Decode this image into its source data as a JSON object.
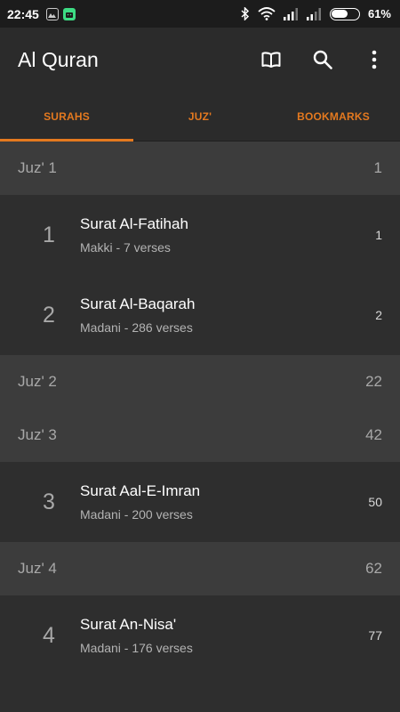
{
  "status_bar": {
    "time": "22:45",
    "battery_text": "61%",
    "battery_level": 0.61,
    "icons": [
      "gallery-icon",
      "android-icon",
      "bluetooth-icon",
      "wifi-icon",
      "signal-icon",
      "signal-icon",
      "battery-icon"
    ]
  },
  "app_bar": {
    "title": "Al Quran",
    "actions": [
      "book-icon",
      "search-icon",
      "overflow-menu-icon"
    ]
  },
  "tabs": [
    {
      "label": "SURAHS",
      "active": true
    },
    {
      "label": "JUZ'",
      "active": false
    },
    {
      "label": "BOOKMARKS",
      "active": false
    }
  ],
  "accent_color": "#e4791f",
  "list": {
    "juz": [
      {
        "label": "Juz' 1",
        "page": "1"
      },
      {
        "label": "Juz' 2",
        "page": "22"
      },
      {
        "label": "Juz' 3",
        "page": "42"
      },
      {
        "label": "Juz' 4",
        "page": "62"
      }
    ],
    "surahs": [
      {
        "number": "1",
        "name": "Surat Al-Fatihah",
        "meta": "Makki - 7 verses",
        "page": "1"
      },
      {
        "number": "2",
        "name": "Surat Al-Baqarah",
        "meta": "Madani - 286 verses",
        "page": "2"
      },
      {
        "number": "3",
        "name": "Surat Aal-E-Imran",
        "meta": "Madani - 200 verses",
        "page": "50"
      },
      {
        "number": "4",
        "name": "Surat An-Nisa'",
        "meta": "Madani - 176 verses",
        "page": "77"
      }
    ]
  }
}
